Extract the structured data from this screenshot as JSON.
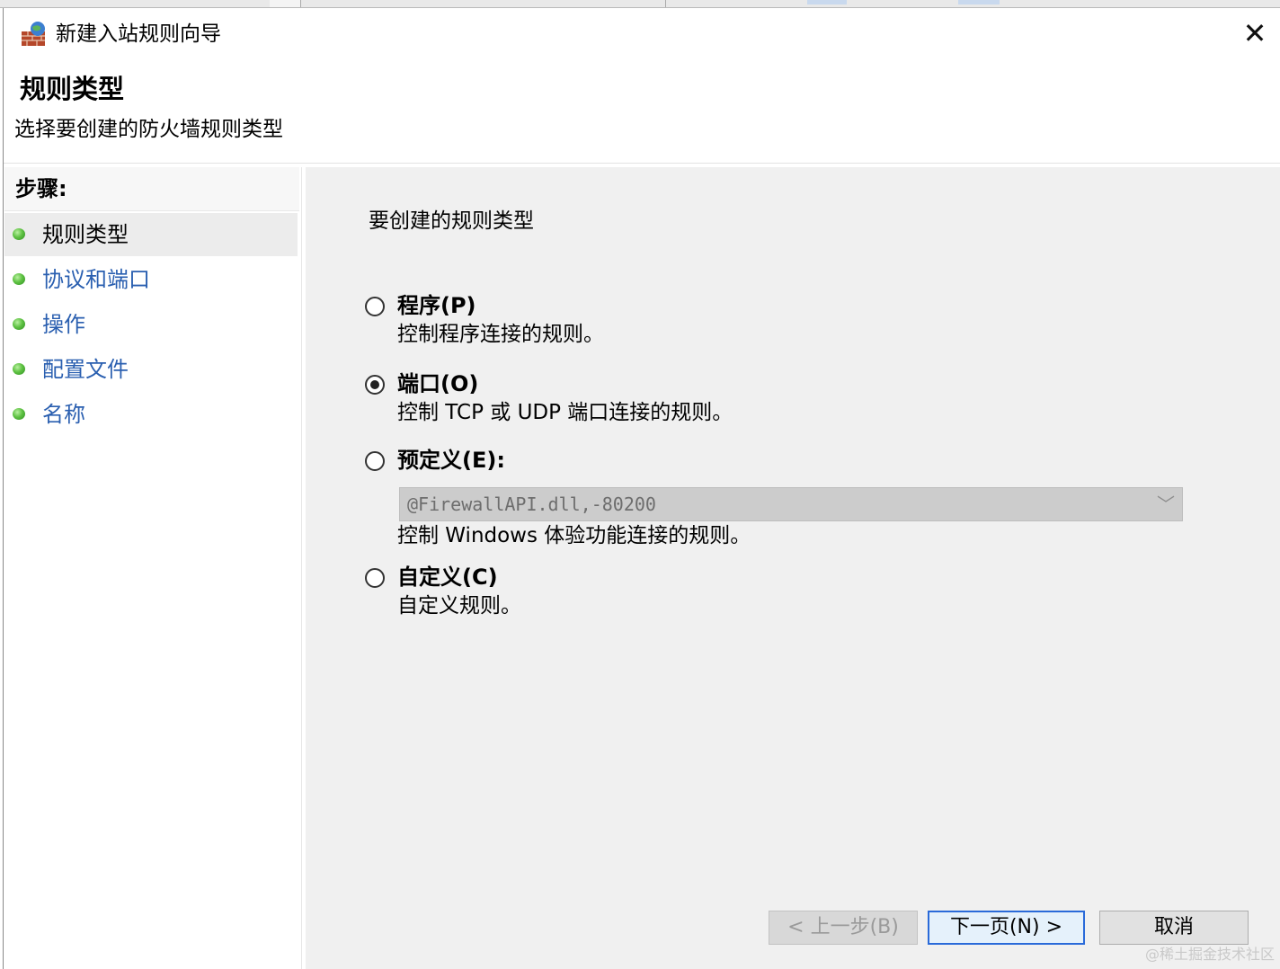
{
  "window": {
    "title": "新建入站规则向导",
    "close_glyph": "✕"
  },
  "header": {
    "title": "规则类型",
    "description": "选择要创建的防火墙规则类型"
  },
  "sidebar": {
    "steps_label": "步骤:",
    "steps": [
      {
        "label": "规则类型",
        "active": true
      },
      {
        "label": "协议和端口",
        "active": false
      },
      {
        "label": "操作",
        "active": false
      },
      {
        "label": "配置文件",
        "active": false
      },
      {
        "label": "名称",
        "active": false
      }
    ]
  },
  "main": {
    "prompt": "要创建的规则类型",
    "options": [
      {
        "title": "程序(P)",
        "description": "控制程序连接的规则。",
        "checked": false
      },
      {
        "title": "端口(O)",
        "description": "控制 TCP 或 UDP 端口连接的规则。",
        "checked": true
      },
      {
        "title": "预定义(E):",
        "description": "控制 Windows 体验功能连接的规则。",
        "checked": false
      },
      {
        "title": "自定义(C)",
        "description": "自定义规则。",
        "checked": false
      }
    ],
    "predefined_select": {
      "value": "@FirewallAPI.dll,-80200",
      "disabled": true,
      "arrow_glyph": "﹀"
    }
  },
  "buttons": {
    "back": "< 上一步(B)",
    "next": "下一页(N) >",
    "cancel": "取消"
  },
  "watermark": "@稀土掘金技术社区",
  "colors": {
    "link": "#2a5fb0",
    "content_bg": "#f0f0f0",
    "next_border": "#2a6ad9"
  },
  "icons": {
    "app": "firewall-wall-icon",
    "step_dot": "green-bullet-icon"
  }
}
